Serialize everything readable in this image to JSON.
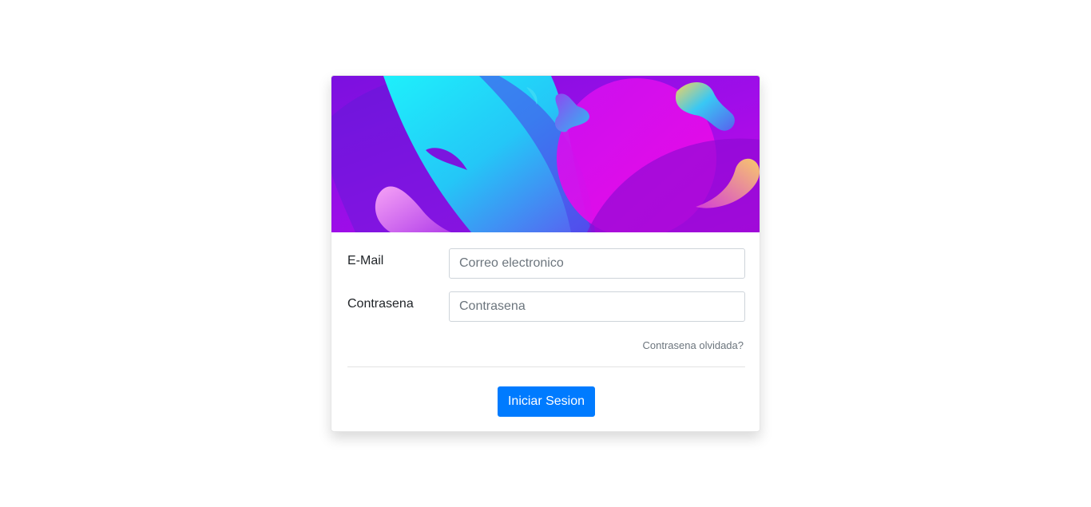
{
  "login_form": {
    "banner_image": "abstract-fluid-gradient-illustration",
    "email": {
      "label": "E-Mail",
      "placeholder": "Correo electronico",
      "value": ""
    },
    "password": {
      "label": "Contrasena",
      "placeholder": "Contrasena",
      "value": ""
    },
    "forgot_password_link": "Contrasena olvidada?",
    "submit_button": "Iniciar Sesion"
  },
  "colors": {
    "primary_button": "#007bff",
    "banner_cyan": "#22e9f7",
    "banner_purple": "#7a10dc",
    "banner_magenta": "#e20ce9",
    "banner_orange": "#f7c06b"
  }
}
